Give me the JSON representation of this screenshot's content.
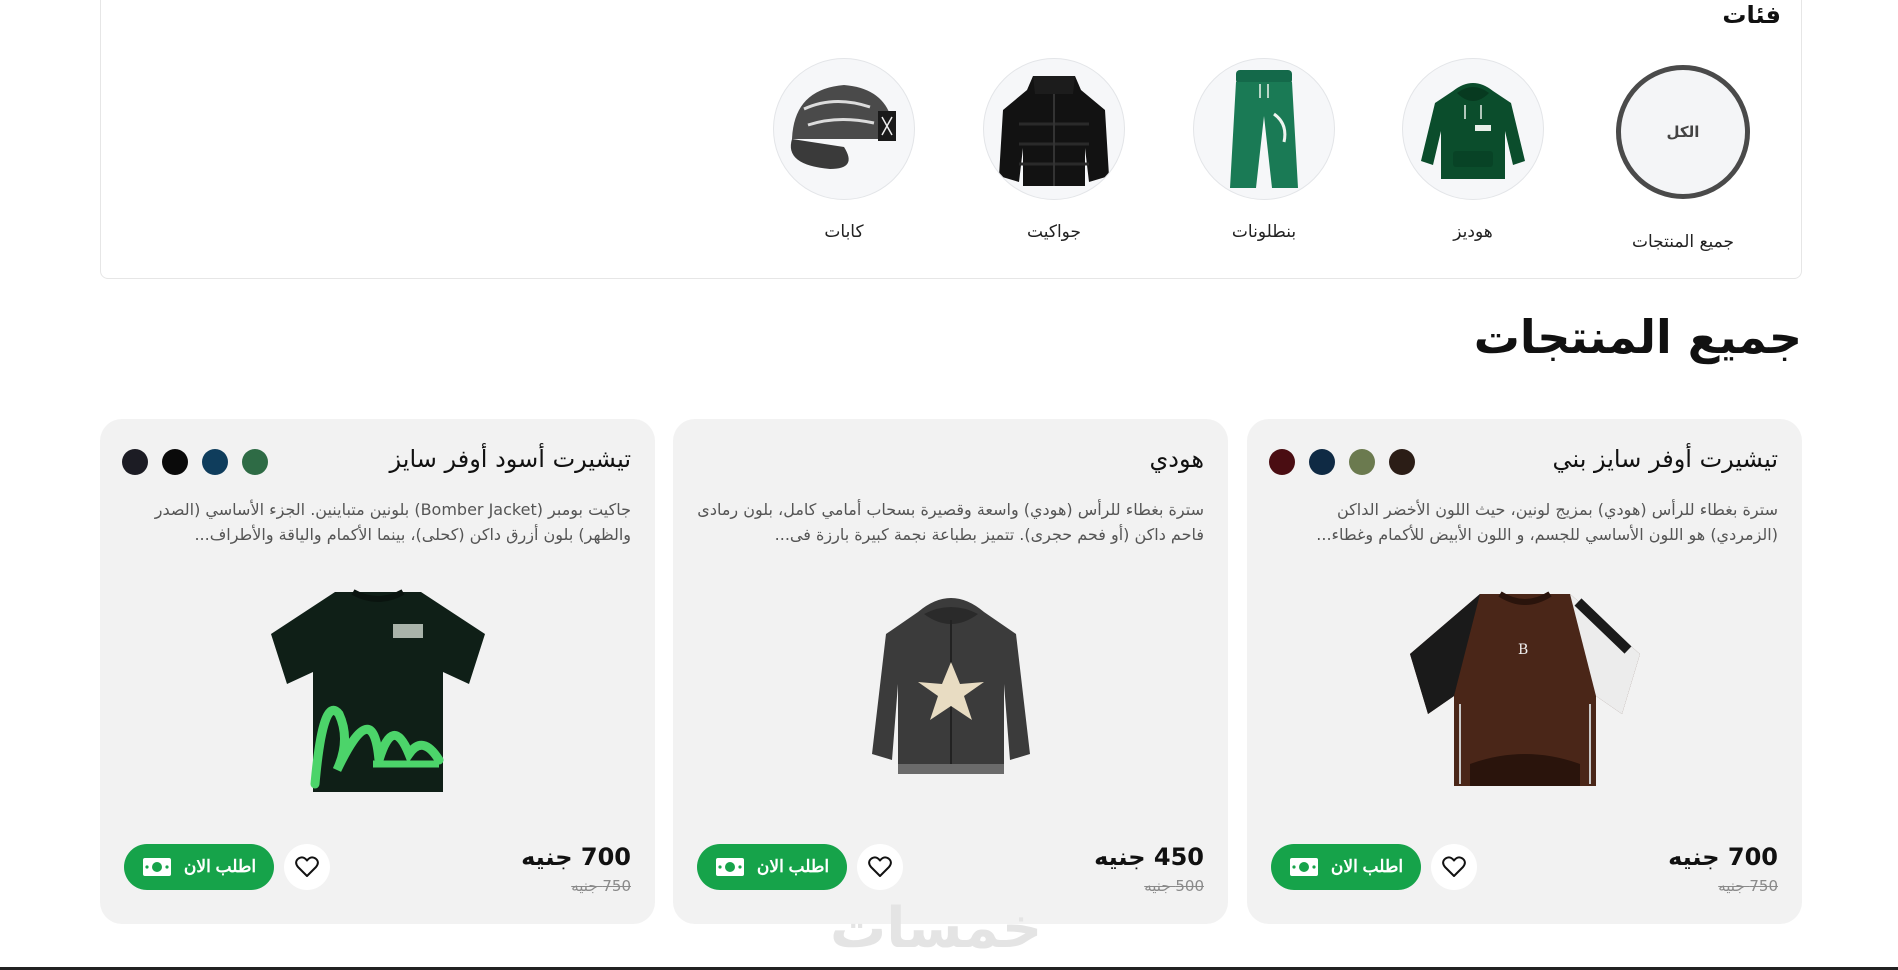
{
  "categories": {
    "title": "فئات",
    "items": [
      {
        "label": "جميع المنتجات",
        "circle_text": "الكل",
        "active": true
      },
      {
        "label": "هوديز",
        "icon": "hoodie-image"
      },
      {
        "label": "بنطلونات",
        "icon": "pants-image"
      },
      {
        "label": "جواكيت",
        "icon": "jacket-image"
      },
      {
        "label": "كابات",
        "icon": "cap-image"
      }
    ]
  },
  "section_title": "جميع المنتجات",
  "products": [
    {
      "title": "تيشيرت أوفر سايز بني",
      "description": "سترة بغطاء للرأس (هودي) بمزيج لونين، حيث اللون الأخضر الداكن (الزمردي) هو اللون الأساسي للجسم، و اللون الأبيض للأكمام وغطاء...",
      "price": "700 جنيه",
      "old_price": "750 جنيه",
      "order_label": "اطلب الان",
      "swatches": [
        "#2b1d16",
        "#6b7a4f",
        "#0f2a44",
        "#4a0d12"
      ],
      "image": "brown-oversized-tshirt"
    },
    {
      "title": "هودي",
      "description": "سترة بغطاء للرأس (هودي) واسعة وقصيرة بسحاب أمامي كامل، بلون رمادى فاحم داكن (أو فحم حجرى). تتميز بطباعة نجمة كبيرة بارزة فى...",
      "price": "450 جنيه",
      "old_price": "500 جنيه",
      "order_label": "اطلب الان",
      "swatches": [],
      "image": "grey-star-hoodie"
    },
    {
      "title": "تيشيرت أسود أوفر سايز",
      "description": "جاكيت بومبر (Bomber Jacket) بلونين متباينين. الجزء الأساسي (الصدر والظهر) بلون أزرق داكن (كحلى)، بينما الأكمام والياقة والأطراف...",
      "price": "700 جنيه",
      "old_price": "750 جنيه",
      "order_label": "اطلب الان",
      "swatches": [
        "#2e6b45",
        "#0f3d5c",
        "#0a0a0a",
        "#1c1c24"
      ],
      "image": "black-oversized-tshirt"
    }
  ],
  "colors": {
    "accent_green": "#16a34a",
    "card_bg": "#f2f2f2"
  },
  "watermark": "خمسات"
}
